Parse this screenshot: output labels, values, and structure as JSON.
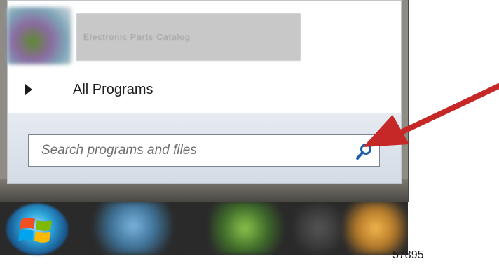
{
  "start_menu": {
    "pinned_app": {
      "label": "Electronic Parts Catalog",
      "icon": "app-icon"
    },
    "all_programs": {
      "label": "All Programs",
      "icon": "triangle-right-icon"
    },
    "search": {
      "placeholder": "Search programs and files",
      "icon": "search-icon"
    }
  },
  "taskbar": {
    "start_button": {
      "icon": "windows-logo-icon"
    }
  },
  "callout": {
    "icon": "red-arrow-icon",
    "color": "#c62828"
  },
  "figure_number": "57895",
  "colors": {
    "taskbar": "#2a2a2a",
    "search_area": "#dfe5ec",
    "arrow": "#c62828"
  }
}
